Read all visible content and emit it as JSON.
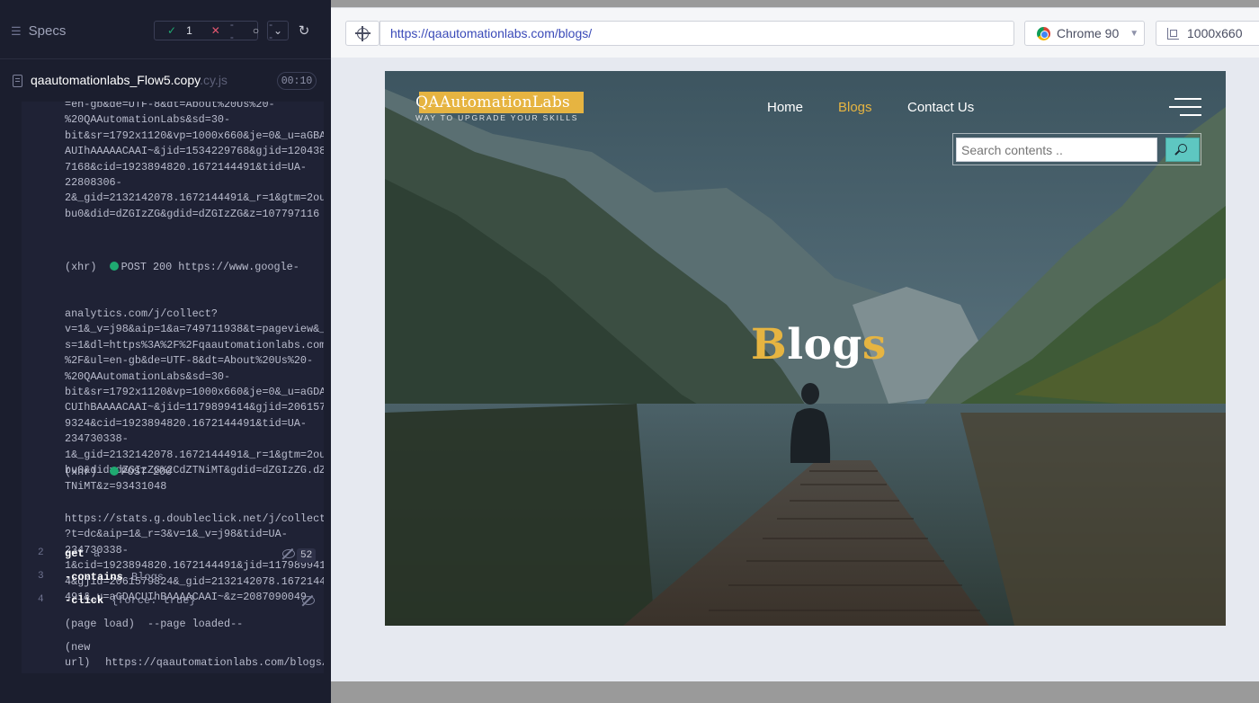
{
  "reporter": {
    "specs_label": "Specs",
    "stats": {
      "passed": "1",
      "failed": "--",
      "pending": "--"
    },
    "spec_file": {
      "name": "qaautomationlabs_Flow5.copy",
      "ext": ".cy.js"
    },
    "timer": "00:10",
    "log_block_1": "=en-gb&de=UTF-8&dt=About%20Us%20-\n%20QAAutomationLabs&sd=30-\nbit&sr=1792x1120&vp=1000x660&je=0&_u=aGBA\nAUIhAAAAACAAI~&jid=1534229768&gjid=120438\n7168&cid=1923894820.1672144491&tid=UA-\n22808306-\n2&_gid=2132142078.1672144491&_r=1&gtm=2ou\nbu0&did=dZGIzZG&gdid=dZGIzZG&z=107797116",
    "xhr_1": {
      "label": "(xhr)",
      "status": "POST 200 https://www.google-",
      "body": "analytics.com/j/collect?\nv=1&_v=j98&aip=1&a=749711938&t=pageview&_\ns=1&dl=https%3A%2F%2Fqaautomationlabs.com\n%2F&ul=en-gb&de=UTF-8&dt=About%20Us%20-\n%20QAAutomationLabs&sd=30-\nbit&sr=1792x1120&vp=1000x660&je=0&_u=aGDA\nCUIhBAAAACAAI~&jid=1179899414&gjid=206157\n9324&cid=1923894820.1672144491&tid=UA-\n234730338-\n1&_gid=2132142078.1672144491&_r=1&gtm=2ou\nbu0&did=dZGIzZG%2CdZTNiMT&gdid=dZGIzZG.dZ\nTNiMT&z=93431048"
    },
    "xhr_2": {
      "label": "(xhr)",
      "status": "POST 200",
      "body": "https://stats.g.doubleclick.net/j/collect\n?t=dc&aip=1&_r=3&v=1&_v=j98&tid=UA-\n234730338-\n1&cid=1923894820.1672144491&jid=117989941\n4&gjid=2061579324&_gid=2132142078.1672144\n491&_u=aGDACUIhBAAAACAAI~&z=2087090049"
    },
    "commands": [
      {
        "num": "2",
        "name": "get",
        "arg": "a",
        "count": "52"
      },
      {
        "num": "3",
        "name": "-contains",
        "arg": "Blogs"
      },
      {
        "num": "4",
        "name": "-click",
        "arg": "{force: true}"
      }
    ],
    "page_load": {
      "label": "(page load)",
      "text": "--page loaded--"
    },
    "new_url": {
      "label": "(new\nurl)",
      "text": "https://qaautomationlabs.com/blogs/"
    }
  },
  "toolbar": {
    "url": "https://qaautomationlabs.com/blogs/",
    "browser": "Chrome 90",
    "viewport": "1000x660"
  },
  "site": {
    "logo": "QAAutomationLabs",
    "tagline": "WAY TO UPGRADE YOUR SKILLS",
    "nav": {
      "home": "Home",
      "blogs": "Blogs",
      "contact": "Contact Us"
    },
    "search_placeholder": "Search contents ..",
    "hero_first": "B",
    "hero_middle": "log",
    "hero_last": "s"
  },
  "colors": {
    "accent_gold": "#e6b441",
    "pass_green": "#1fa971",
    "fail_red": "#e45770",
    "search_teal": "#5ec7c1",
    "reporter_bg": "#1b1e2e"
  }
}
